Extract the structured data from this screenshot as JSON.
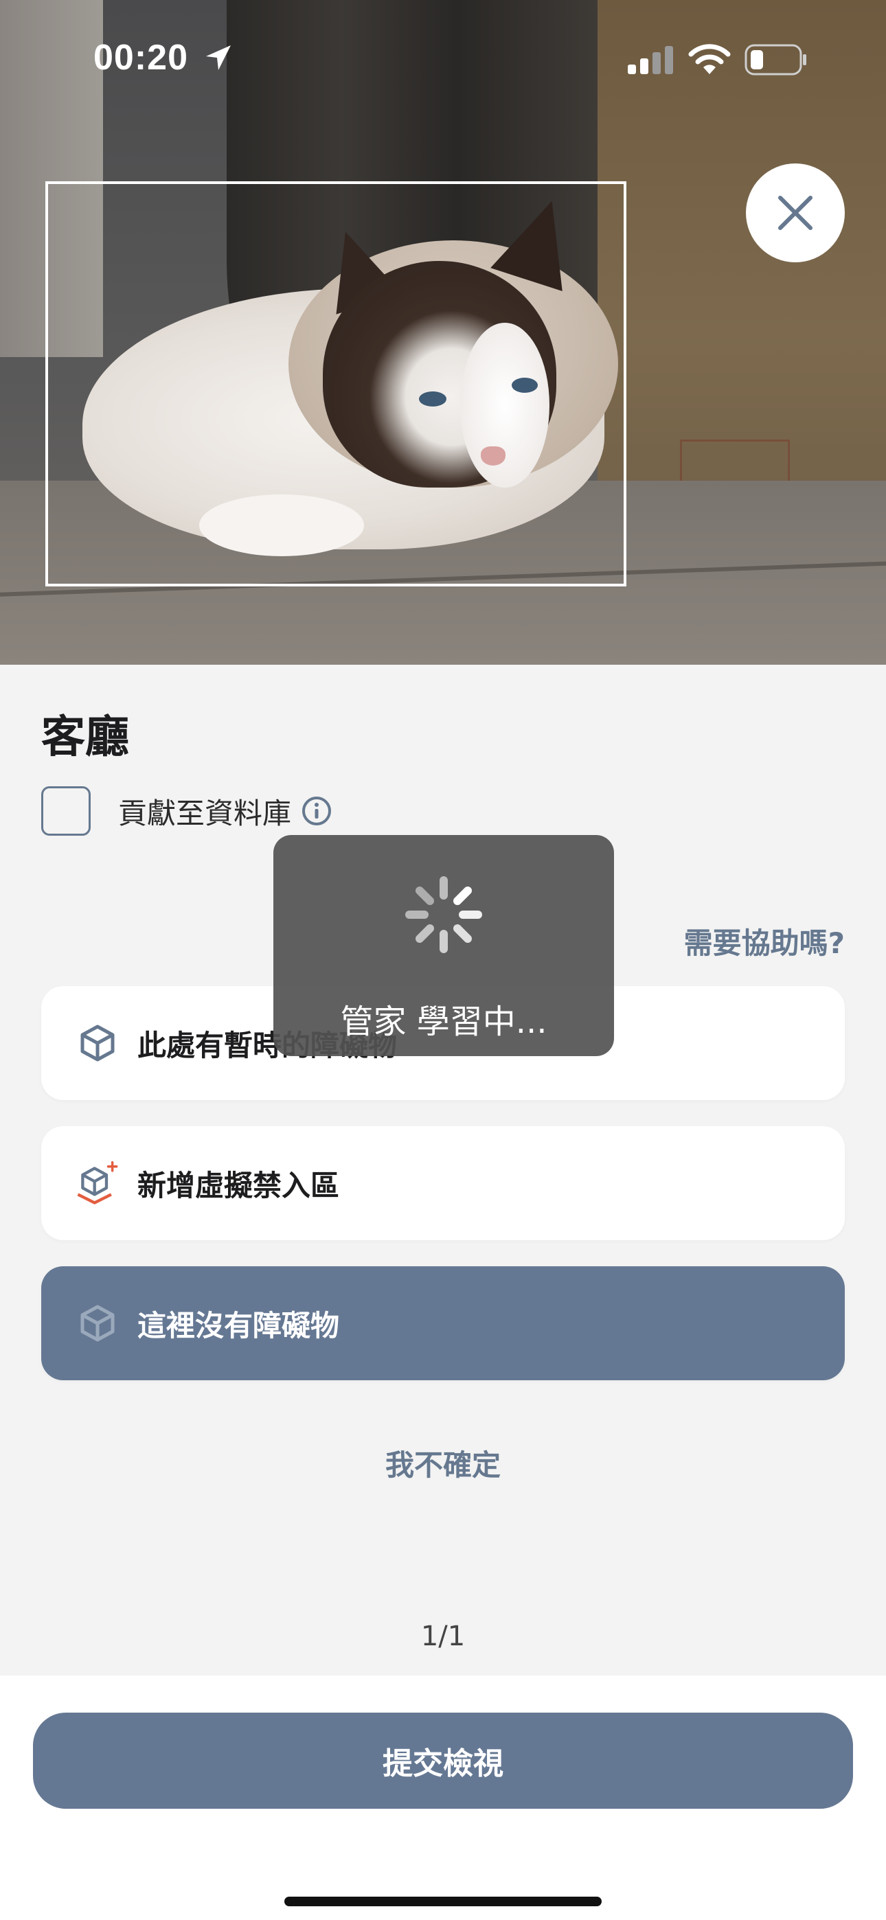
{
  "status_bar": {
    "time": "00:20",
    "icons": [
      "location-arrow-icon",
      "cellular-signal-icon",
      "wifi-icon",
      "battery-icon"
    ]
  },
  "camera": {
    "image": "cat-photo",
    "close_icon": "close-icon"
  },
  "room": {
    "title": "客廳"
  },
  "contribute": {
    "label": "貢獻至資料庫",
    "checked": false,
    "icon": "info-icon"
  },
  "help": {
    "label": "需要協助嗎?"
  },
  "options": [
    {
      "label": "此處有暫時的障礙物",
      "icon": "cube-icon",
      "selected": false
    },
    {
      "label": "新增虛擬禁入區",
      "icon": "cube-plus-icon",
      "selected": false
    },
    {
      "label": "這裡沒有障礙物",
      "icon": "cube-icon",
      "selected": true
    }
  ],
  "unsure": {
    "label": "我不確定"
  },
  "pager": {
    "text": "1/1"
  },
  "toast": {
    "text": "管家 學習中..."
  },
  "submit": {
    "label": "提交檢視"
  },
  "colors": {
    "accent": "#657893",
    "background": "#f3f3f3",
    "toast_bg": "#525252",
    "plus_accent": "#e35d3f"
  }
}
